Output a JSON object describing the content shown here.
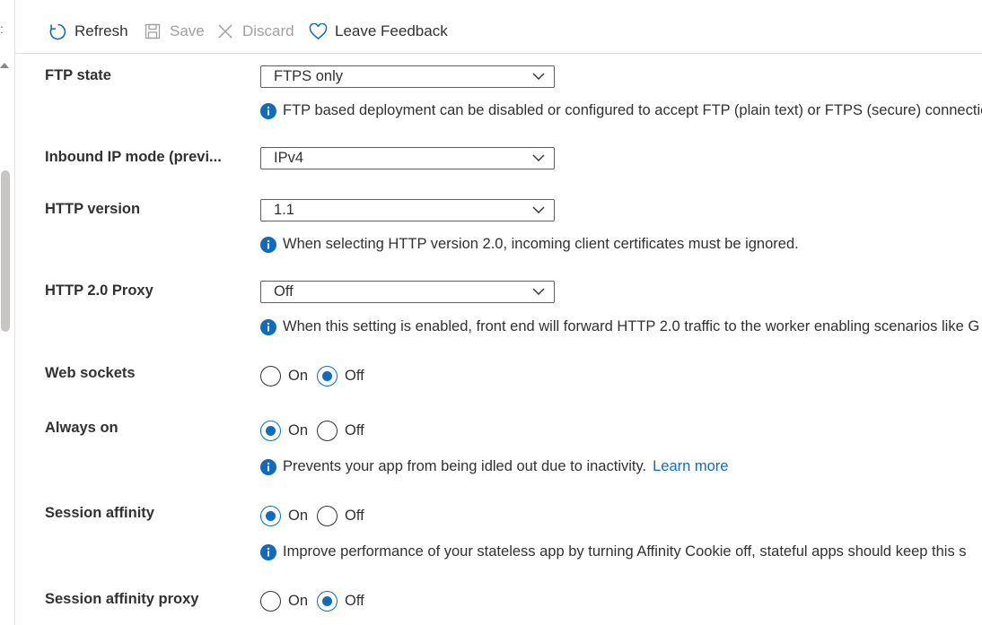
{
  "toolbar": {
    "refresh": "Refresh",
    "save": "Save",
    "discard": "Discard",
    "feedback": "Leave Feedback"
  },
  "settings": {
    "ftp_state": {
      "label": "FTP state",
      "value": "FTPS only",
      "info": "FTP based deployment can be disabled or configured to accept FTP (plain text) or FTPS (secure) connectio"
    },
    "inbound_ip": {
      "label": "Inbound IP mode (previ...",
      "value": "IPv4"
    },
    "http_version": {
      "label": "HTTP version",
      "value": "1.1",
      "info": "When selecting HTTP version 2.0, incoming client certificates must be ignored."
    },
    "http2_proxy": {
      "label": "HTTP 2.0 Proxy",
      "value": "Off",
      "info": "When this setting is enabled, front end will forward HTTP 2.0 traffic to the worker enabling scenarios like G"
    },
    "web_sockets": {
      "label": "Web sockets",
      "on": "On",
      "off": "Off",
      "selected": "Off"
    },
    "always_on": {
      "label": "Always on",
      "on": "On",
      "off": "Off",
      "selected": "On",
      "info": "Prevents your app from being idled out due to inactivity.",
      "link": "Learn more"
    },
    "session_affinity": {
      "label": "Session affinity",
      "on": "On",
      "off": "Off",
      "selected": "On",
      "info": "Improve performance of your stateless app by turning Affinity Cookie off, stateful apps should keep this s"
    },
    "session_affinity_proxy": {
      "label": "Session affinity proxy",
      "on": "On",
      "off": "Off",
      "selected": "Off"
    }
  },
  "colors": {
    "accent": "#0f6cbd",
    "text": "#323130",
    "disabled": "#a19f9d",
    "border": "#605e5c"
  }
}
